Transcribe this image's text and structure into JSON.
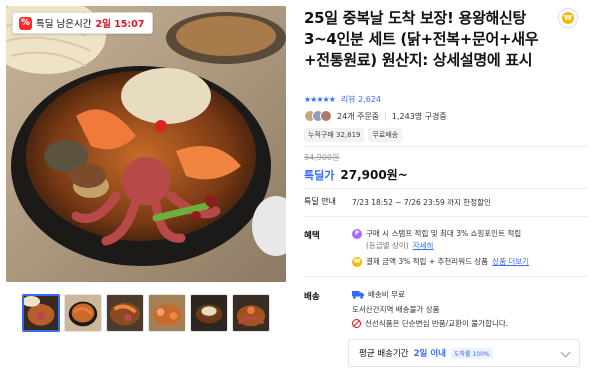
{
  "gallery": {
    "badge": {
      "icon": "percent-icon",
      "prefix": "특딜 남은시간",
      "time": "2일 15:07"
    },
    "thumbnail_count": 6,
    "active_thumbnail": 0
  },
  "product": {
    "title": "25일 중복날 도착 보장! 용왕해신탕 3~4인분 세트 (닭+전복+문어+새우+전통원료) 원산지: 상세설명에 표시",
    "rating": 4.5,
    "stars": "★★★★★",
    "review_label": "리뷰 2,624",
    "ordered_24h": "24개 주문중",
    "watching": "1,243명 구경중",
    "chips": [
      "누적구매 32,819",
      "무료배송"
    ]
  },
  "price": {
    "original": "34,900원",
    "deal_label": "특딜가",
    "sale": "27,900원~"
  },
  "deal_notice": {
    "label": "특딜 안내",
    "period": "7/23 18:52 ~ 7/26 23:59 까지 한정할인"
  },
  "benefits": {
    "label": "혜택",
    "line1": "구매 시 스탬프 적립 및 최대 3% 쇼핑포인트 적립",
    "line1b": "(등급별 상이)",
    "line1_link": "자세히",
    "line2": "결제 금액 3% 적립 + 추천리워드 상품",
    "line2_link": "상품 더보기"
  },
  "shipping": {
    "label": "배송",
    "fee": "배송비 무료",
    "note": "도서산간지역 배송불가 상품",
    "warning": "신선식품은 단순변심 반품/교환이 불가합니다."
  },
  "avg_delivery": {
    "label": "평균 배송기간",
    "value": "2일 이내",
    "pill": "도착률 100%"
  },
  "colors": {
    "accent": "#346aff",
    "badge_red": "#ff2a2a",
    "coin": "#f5b800"
  }
}
